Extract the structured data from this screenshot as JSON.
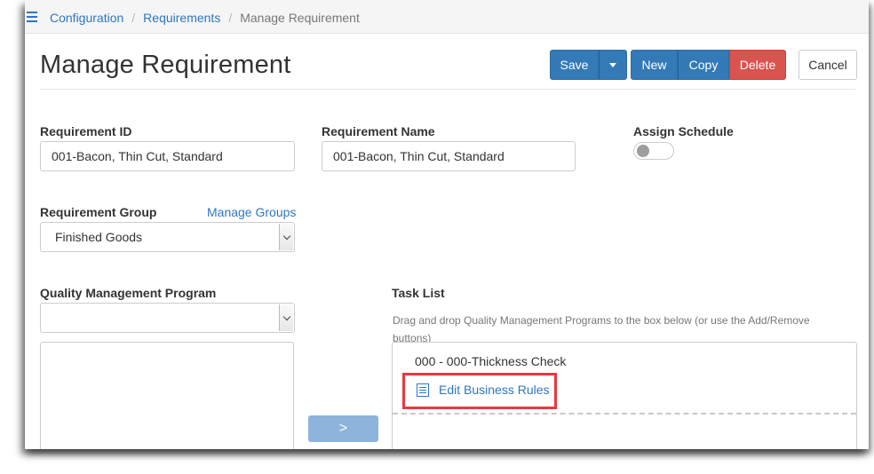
{
  "breadcrumb": [
    "Configuration",
    "Requirements",
    "Manage Requirement"
  ],
  "page_title": "Manage Requirement",
  "toolbar": {
    "save_label": "Save",
    "new_label": "New",
    "copy_label": "Copy",
    "delete_label": "Delete",
    "cancel_label": "Cancel"
  },
  "form": {
    "requirement_id": {
      "label": "Requirement ID",
      "value": "001-Bacon, Thin Cut, Standard"
    },
    "requirement_name": {
      "label": "Requirement Name",
      "value": "001-Bacon, Thin Cut, Standard"
    },
    "assign_schedule": {
      "label": "Assign Schedule",
      "on": false
    },
    "requirement_group": {
      "label": "Requirement Group",
      "manage_link": "Manage Groups",
      "value": "Finished Goods"
    },
    "qm_program": {
      "label": "Quality Management Program",
      "value": ""
    }
  },
  "task_list": {
    "label": "Task List",
    "hint": "Drag and drop Quality Management Programs to the box below (or use the Add/Remove buttons)",
    "items": [
      {
        "name": "000 - 000-Thickness Check",
        "rules_link": "Edit Business Rules"
      }
    ]
  },
  "move_button": ">",
  "colors": {
    "primary": "#337ab7",
    "danger": "#d9534f",
    "link": "#2f76c3",
    "highlight": "#e8393e"
  }
}
